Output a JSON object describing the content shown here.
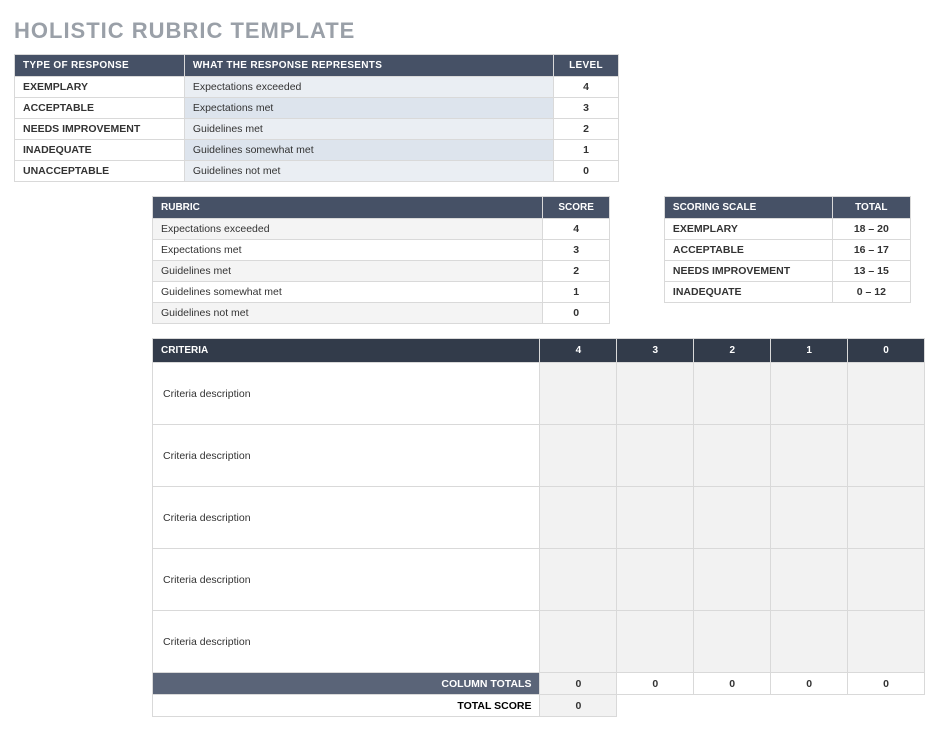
{
  "title": "HOLISTIC RUBRIC TEMPLATE",
  "type_table": {
    "headers": {
      "type": "TYPE OF RESPONSE",
      "represents": "WHAT THE RESPONSE REPRESENTS",
      "level": "LEVEL"
    },
    "rows": [
      {
        "type": "EXEMPLARY",
        "represents": "Expectations exceeded",
        "level": "4"
      },
      {
        "type": "ACCEPTABLE",
        "represents": "Expectations met",
        "level": "3"
      },
      {
        "type": "NEEDS IMPROVEMENT",
        "represents": "Guidelines met",
        "level": "2"
      },
      {
        "type": "INADEQUATE",
        "represents": "Guidelines somewhat met",
        "level": "1"
      },
      {
        "type": "UNACCEPTABLE",
        "represents": "Guidelines not met",
        "level": "0"
      }
    ]
  },
  "rubric_table": {
    "headers": {
      "rubric": "RUBRIC",
      "score": "SCORE"
    },
    "rows": [
      {
        "rubric": "Expectations exceeded",
        "score": "4"
      },
      {
        "rubric": "Expectations met",
        "score": "3"
      },
      {
        "rubric": "Guidelines met",
        "score": "2"
      },
      {
        "rubric": "Guidelines somewhat met",
        "score": "1"
      },
      {
        "rubric": "Guidelines not met",
        "score": "0"
      }
    ]
  },
  "scale_table": {
    "headers": {
      "scale": "SCORING SCALE",
      "total": "TOTAL"
    },
    "rows": [
      {
        "name": "EXEMPLARY",
        "total": "18 – 20"
      },
      {
        "name": "ACCEPTABLE",
        "total": "16 – 17"
      },
      {
        "name": "NEEDS IMPROVEMENT",
        "total": "13 – 15"
      },
      {
        "name": "INADEQUATE",
        "total": "0 – 12"
      }
    ]
  },
  "criteria_table": {
    "headers": {
      "criteria": "CRITERIA",
      "c4": "4",
      "c3": "3",
      "c2": "2",
      "c1": "1",
      "c0": "0"
    },
    "rows": [
      {
        "desc": "Criteria description"
      },
      {
        "desc": "Criteria description"
      },
      {
        "desc": "Criteria description"
      },
      {
        "desc": "Criteria description"
      },
      {
        "desc": "Criteria description"
      }
    ],
    "column_totals_label": "COLUMN TOTALS",
    "column_totals": [
      "0",
      "0",
      "0",
      "0",
      "0"
    ],
    "total_score_label": "TOTAL SCORE",
    "total_score": "0"
  }
}
